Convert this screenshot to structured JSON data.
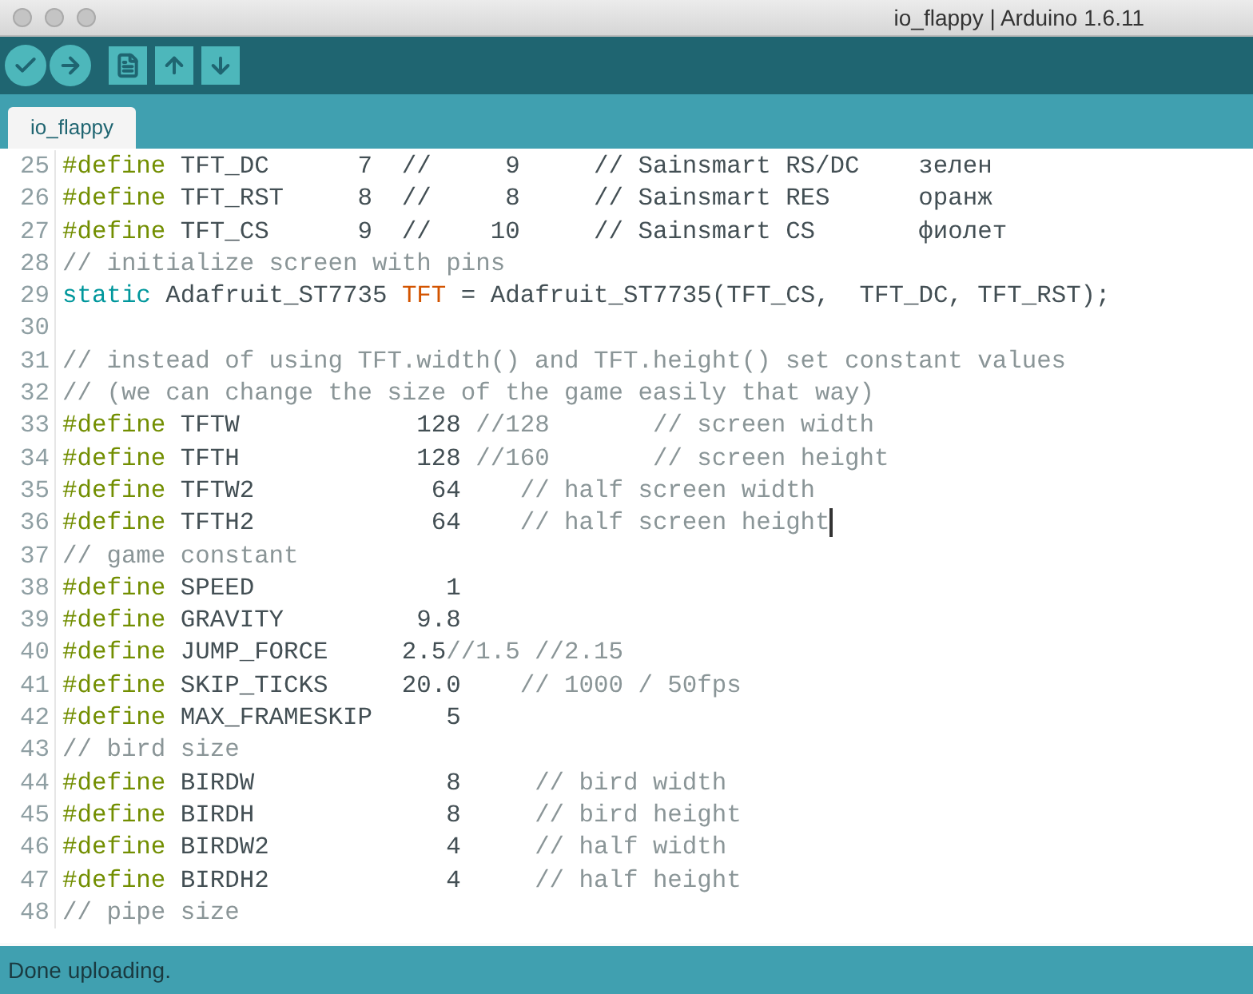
{
  "window": {
    "title": "io_flappy | Arduino 1.6.11"
  },
  "toolbar": [
    {
      "kind": "verify"
    },
    {
      "kind": "upload"
    },
    {
      "kind": "new"
    },
    {
      "kind": "open"
    },
    {
      "kind": "save"
    }
  ],
  "tabs": [
    {
      "label": "io_flappy",
      "selected": true
    }
  ],
  "editor": {
    "lines": [
      {
        "number": "25",
        "caret": false,
        "tokens": [
          {
            "kind": "keyword",
            "text": "#define"
          },
          {
            "kind": "plain",
            "text": " TFT_DC      7  //     9     // Sainsmart RS/DC    зелен"
          }
        ]
      },
      {
        "number": "26",
        "caret": false,
        "tokens": [
          {
            "kind": "keyword",
            "text": "#define"
          },
          {
            "kind": "plain",
            "text": " TFT_RST     8  //     8     // Sainsmart RES      оранж"
          }
        ]
      },
      {
        "number": "27",
        "caret": false,
        "tokens": [
          {
            "kind": "keyword",
            "text": "#define"
          },
          {
            "kind": "plain",
            "text": " TFT_CS      9  //    10     // Sainsmart CS       фиолет"
          }
        ]
      },
      {
        "number": "28",
        "caret": false,
        "tokens": [
          {
            "kind": "comment",
            "text": "// initialize screen with pins"
          }
        ]
      },
      {
        "number": "29",
        "caret": false,
        "tokens": [
          {
            "kind": "type",
            "text": "static"
          },
          {
            "kind": "plain",
            "text": " Adafruit_ST7735 "
          },
          {
            "kind": "ident",
            "text": "TFT"
          },
          {
            "kind": "plain",
            "text": " = Adafruit_ST7735(TFT_CS,  TFT_DC, TFT_RST);"
          }
        ]
      },
      {
        "number": "30",
        "caret": false
      },
      {
        "number": "31",
        "caret": false,
        "tokens": [
          {
            "kind": "comment",
            "text": "// instead of using TFT.width() and TFT.height() set constant values"
          }
        ]
      },
      {
        "number": "32",
        "caret": false,
        "tokens": [
          {
            "kind": "comment",
            "text": "// (we can change the size of the game easily that way)"
          }
        ]
      },
      {
        "number": "33",
        "caret": false,
        "tokens": [
          {
            "kind": "keyword",
            "text": "#define"
          },
          {
            "kind": "plain",
            "text": " TFTW            128 "
          },
          {
            "kind": "comment",
            "text": "//128       // screen width"
          }
        ]
      },
      {
        "number": "34",
        "caret": false,
        "tokens": [
          {
            "kind": "keyword",
            "text": "#define"
          },
          {
            "kind": "plain",
            "text": " TFTH            128 "
          },
          {
            "kind": "comment",
            "text": "//160       // screen height"
          }
        ]
      },
      {
        "number": "35",
        "caret": false,
        "tokens": [
          {
            "kind": "keyword",
            "text": "#define"
          },
          {
            "kind": "plain",
            "text": " TFTW2            64    "
          },
          {
            "kind": "comment",
            "text": "// half screen width"
          }
        ]
      },
      {
        "number": "36",
        "caret": true,
        "tokens": [
          {
            "kind": "keyword",
            "text": "#define"
          },
          {
            "kind": "plain",
            "text": " TFTH2            64    "
          },
          {
            "kind": "comment",
            "text": "// half screen height"
          }
        ]
      },
      {
        "number": "37",
        "caret": false,
        "tokens": [
          {
            "kind": "comment",
            "text": "// game constant"
          }
        ]
      },
      {
        "number": "38",
        "caret": false,
        "tokens": [
          {
            "kind": "keyword",
            "text": "#define"
          },
          {
            "kind": "plain",
            "text": " SPEED             1"
          }
        ]
      },
      {
        "number": "39",
        "caret": false,
        "tokens": [
          {
            "kind": "keyword",
            "text": "#define"
          },
          {
            "kind": "plain",
            "text": " GRAVITY         9.8"
          }
        ]
      },
      {
        "number": "40",
        "caret": false,
        "tokens": [
          {
            "kind": "keyword",
            "text": "#define"
          },
          {
            "kind": "plain",
            "text": " JUMP_FORCE     2.5"
          },
          {
            "kind": "comment",
            "text": "//1.5 //2.15"
          }
        ]
      },
      {
        "number": "41",
        "caret": false,
        "tokens": [
          {
            "kind": "keyword",
            "text": "#define"
          },
          {
            "kind": "plain",
            "text": " SKIP_TICKS     20.0    "
          },
          {
            "kind": "comment",
            "text": "// 1000 / 50fps"
          }
        ]
      },
      {
        "number": "42",
        "caret": false,
        "tokens": [
          {
            "kind": "keyword",
            "text": "#define"
          },
          {
            "kind": "plain",
            "text": " MAX_FRAMESKIP     5"
          }
        ]
      },
      {
        "number": "43",
        "caret": false,
        "tokens": [
          {
            "kind": "comment",
            "text": "// bird size"
          }
        ]
      },
      {
        "number": "44",
        "caret": false,
        "tokens": [
          {
            "kind": "keyword",
            "text": "#define"
          },
          {
            "kind": "plain",
            "text": " BIRDW             8     "
          },
          {
            "kind": "comment",
            "text": "// bird width"
          }
        ]
      },
      {
        "number": "45",
        "caret": false,
        "tokens": [
          {
            "kind": "keyword",
            "text": "#define"
          },
          {
            "kind": "plain",
            "text": " BIRDH             8     "
          },
          {
            "kind": "comment",
            "text": "// bird height"
          }
        ]
      },
      {
        "number": "46",
        "caret": false,
        "tokens": [
          {
            "kind": "keyword",
            "text": "#define"
          },
          {
            "kind": "plain",
            "text": " BIRDW2            4     "
          },
          {
            "kind": "comment",
            "text": "// half width"
          }
        ]
      },
      {
        "number": "47",
        "caret": false,
        "tokens": [
          {
            "kind": "keyword",
            "text": "#define"
          },
          {
            "kind": "plain",
            "text": " BIRDH2            4     "
          },
          {
            "kind": "comment",
            "text": "// half height"
          }
        ]
      },
      {
        "number": "48",
        "caret": false,
        "tokens": [
          {
            "kind": "comment",
            "text": "// pipe size"
          }
        ]
      }
    ]
  },
  "status_bar": {
    "message": "Done uploading."
  }
}
